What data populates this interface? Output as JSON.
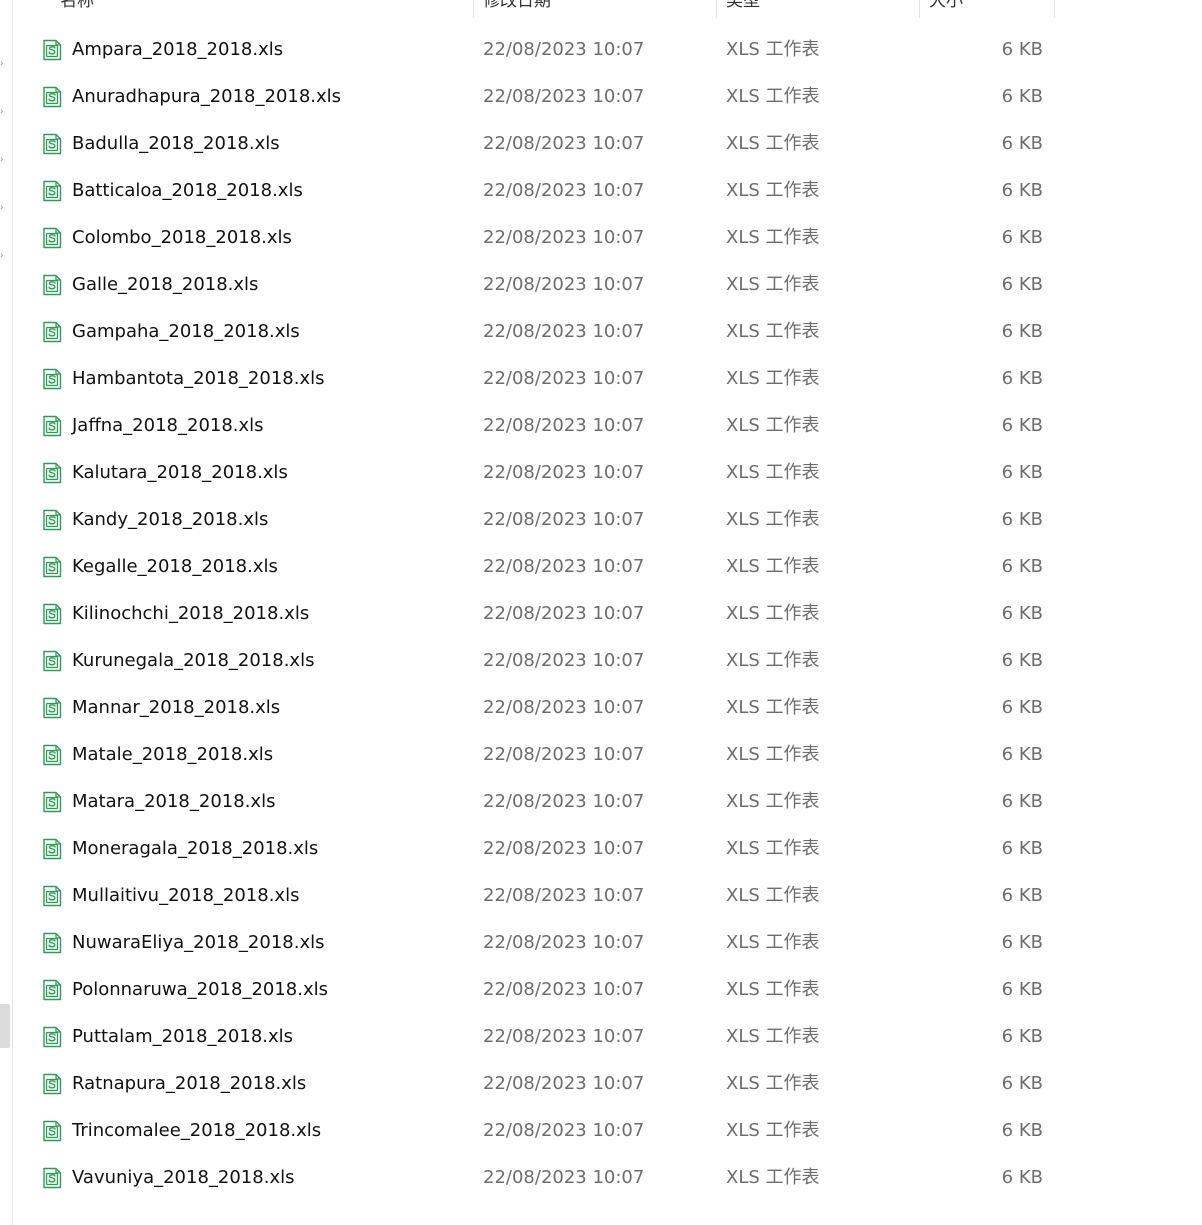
{
  "header": {
    "col_name": "名称",
    "col_date": "修改日期",
    "col_type": "类型",
    "col_size": "大小"
  },
  "file_icon": "spreadsheet-file-icon",
  "colors": {
    "icon_green": "#2e9a57",
    "text_primary": "#111111",
    "text_secondary": "#6d6d6d"
  },
  "files": [
    {
      "name": "Ampara_2018_2018.xls",
      "date": "22/08/2023 10:07",
      "type": "XLS 工作表",
      "size": "6 KB"
    },
    {
      "name": "Anuradhapura_2018_2018.xls",
      "date": "22/08/2023 10:07",
      "type": "XLS 工作表",
      "size": "6 KB"
    },
    {
      "name": "Badulla_2018_2018.xls",
      "date": "22/08/2023 10:07",
      "type": "XLS 工作表",
      "size": "6 KB"
    },
    {
      "name": "Batticaloa_2018_2018.xls",
      "date": "22/08/2023 10:07",
      "type": "XLS 工作表",
      "size": "6 KB"
    },
    {
      "name": "Colombo_2018_2018.xls",
      "date": "22/08/2023 10:07",
      "type": "XLS 工作表",
      "size": "6 KB"
    },
    {
      "name": "Galle_2018_2018.xls",
      "date": "22/08/2023 10:07",
      "type": "XLS 工作表",
      "size": "6 KB"
    },
    {
      "name": "Gampaha_2018_2018.xls",
      "date": "22/08/2023 10:07",
      "type": "XLS 工作表",
      "size": "6 KB"
    },
    {
      "name": "Hambantota_2018_2018.xls",
      "date": "22/08/2023 10:07",
      "type": "XLS 工作表",
      "size": "6 KB"
    },
    {
      "name": "Jaffna_2018_2018.xls",
      "date": "22/08/2023 10:07",
      "type": "XLS 工作表",
      "size": "6 KB"
    },
    {
      "name": "Kalutara_2018_2018.xls",
      "date": "22/08/2023 10:07",
      "type": "XLS 工作表",
      "size": "6 KB"
    },
    {
      "name": "Kandy_2018_2018.xls",
      "date": "22/08/2023 10:07",
      "type": "XLS 工作表",
      "size": "6 KB"
    },
    {
      "name": "Kegalle_2018_2018.xls",
      "date": "22/08/2023 10:07",
      "type": "XLS 工作表",
      "size": "6 KB"
    },
    {
      "name": "Kilinochchi_2018_2018.xls",
      "date": "22/08/2023 10:07",
      "type": "XLS 工作表",
      "size": "6 KB"
    },
    {
      "name": "Kurunegala_2018_2018.xls",
      "date": "22/08/2023 10:07",
      "type": "XLS 工作表",
      "size": "6 KB"
    },
    {
      "name": "Mannar_2018_2018.xls",
      "date": "22/08/2023 10:07",
      "type": "XLS 工作表",
      "size": "6 KB"
    },
    {
      "name": "Matale_2018_2018.xls",
      "date": "22/08/2023 10:07",
      "type": "XLS 工作表",
      "size": "6 KB"
    },
    {
      "name": "Matara_2018_2018.xls",
      "date": "22/08/2023 10:07",
      "type": "XLS 工作表",
      "size": "6 KB"
    },
    {
      "name": "Moneragala_2018_2018.xls",
      "date": "22/08/2023 10:07",
      "type": "XLS 工作表",
      "size": "6 KB"
    },
    {
      "name": "Mullaitivu_2018_2018.xls",
      "date": "22/08/2023 10:07",
      "type": "XLS 工作表",
      "size": "6 KB"
    },
    {
      "name": "NuwaraEliya_2018_2018.xls",
      "date": "22/08/2023 10:07",
      "type": "XLS 工作表",
      "size": "6 KB"
    },
    {
      "name": "Polonnaruwa_2018_2018.xls",
      "date": "22/08/2023 10:07",
      "type": "XLS 工作表",
      "size": "6 KB"
    },
    {
      "name": "Puttalam_2018_2018.xls",
      "date": "22/08/2023 10:07",
      "type": "XLS 工作表",
      "size": "6 KB"
    },
    {
      "name": "Ratnapura_2018_2018.xls",
      "date": "22/08/2023 10:07",
      "type": "XLS 工作表",
      "size": "6 KB"
    },
    {
      "name": "Trincomalee_2018_2018.xls",
      "date": "22/08/2023 10:07",
      "type": "XLS 工作表",
      "size": "6 KB"
    },
    {
      "name": "Vavuniya_2018_2018.xls",
      "date": "22/08/2023 10:07",
      "type": "XLS 工作表",
      "size": "6 KB"
    }
  ]
}
